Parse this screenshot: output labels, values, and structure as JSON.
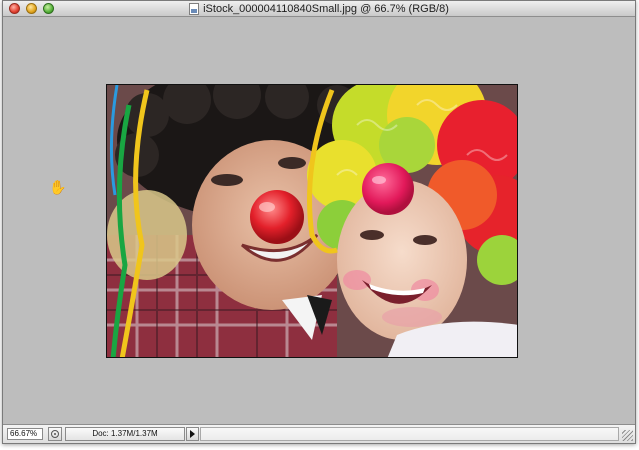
{
  "window": {
    "title": "iStock_000004110840Small.jpg @ 66.7% (RGB/8)"
  },
  "status_bar": {
    "zoom_value": "66.67%",
    "doc_info": "Doc: 1.37M/1.37M"
  },
  "icons": {
    "close": "close-button",
    "minimize": "minimize-button",
    "zoom": "zoom-button",
    "cursor": "hand-cursor-icon",
    "document": "document-icon"
  },
  "colors": {
    "canvas_gray": "#bdbdbd",
    "close_red": "#e2402f",
    "minimize_yellow": "#e2a51d",
    "zoom_green": "#56b23a"
  }
}
